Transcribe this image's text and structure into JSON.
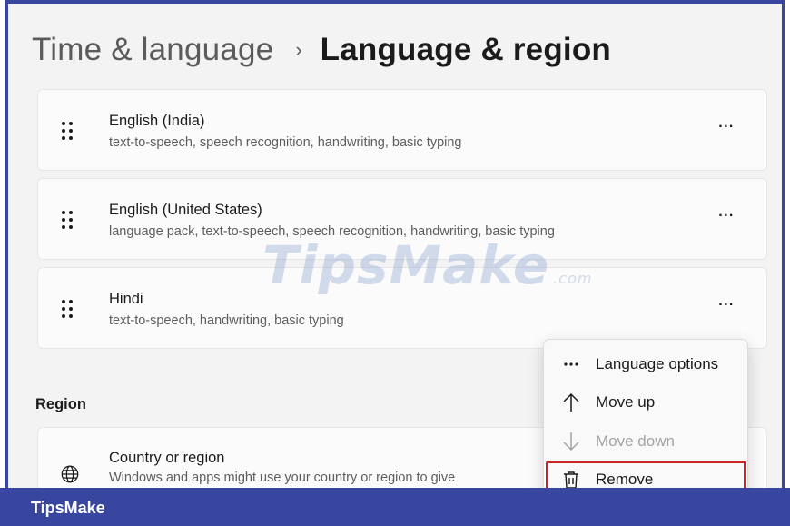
{
  "header": {
    "breadcrumb_parent": "Time & language",
    "breadcrumb_separator": "›",
    "page_title": "Language & region"
  },
  "languages": [
    {
      "name": "English (India)",
      "features": "text-to-speech, speech recognition, handwriting, basic typing"
    },
    {
      "name": "English (United States)",
      "features": "language pack, text-to-speech, speech recognition, handwriting, basic typing"
    },
    {
      "name": "Hindi",
      "features": "text-to-speech, handwriting, basic typing"
    }
  ],
  "more_label": "···",
  "region": {
    "section_label": "Region",
    "country_title": "Country or region",
    "country_desc": "Windows and apps might use your country or region to give"
  },
  "context_menu": {
    "items": [
      {
        "label": "Language options",
        "icon": "more-horizontal-icon",
        "enabled": true
      },
      {
        "label": "Move up",
        "icon": "arrow-up-icon",
        "enabled": true
      },
      {
        "label": "Move down",
        "icon": "arrow-down-icon",
        "enabled": false
      },
      {
        "label": "Remove",
        "icon": "trash-icon",
        "enabled": true,
        "highlighted": true
      }
    ]
  },
  "watermark": {
    "main": "TipsMake",
    "suffix": ".com"
  },
  "footer": {
    "brand": "TipsMake"
  },
  "colors": {
    "frame": "#3946a0",
    "highlight": "#d0212a",
    "background": "#f3f3f3",
    "card": "#fbfbfb"
  }
}
